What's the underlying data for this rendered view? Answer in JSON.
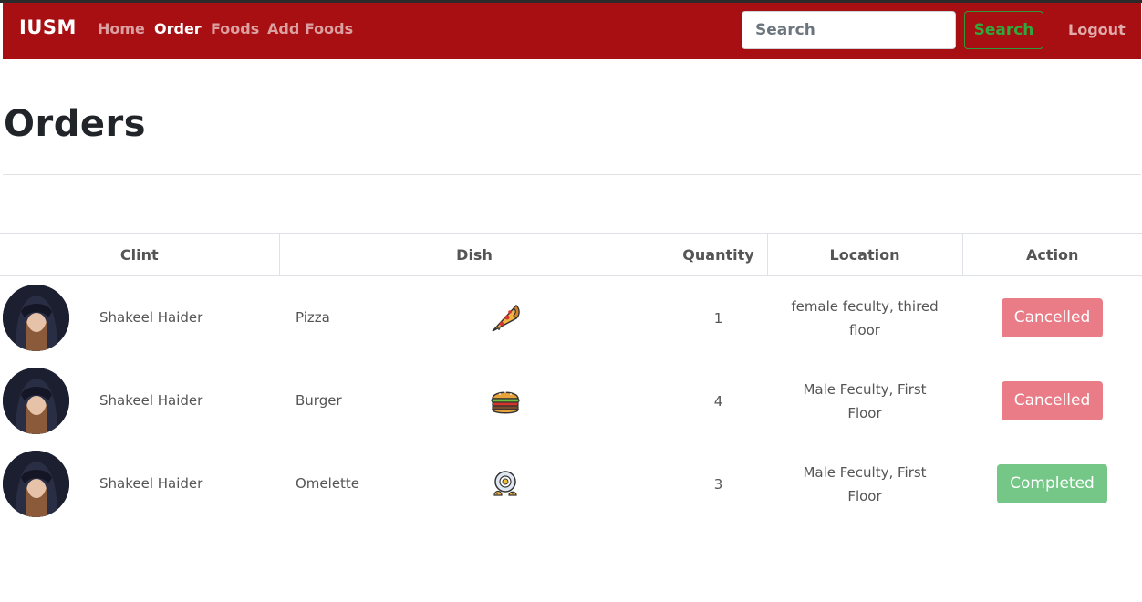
{
  "navbar": {
    "brand": "IUSM",
    "links": [
      {
        "label": "Home",
        "active": false
      },
      {
        "label": "Order",
        "active": true
      },
      {
        "label": "Foods",
        "active": false
      },
      {
        "label": "Add Foods",
        "active": false
      }
    ],
    "search_placeholder": "Search",
    "search_button": "Search",
    "logout": "Logout"
  },
  "colors": {
    "navbar_bg": "#a80f12",
    "search_button": "#2fa83c",
    "cancelled": "#e97c86",
    "completed": "#74c786"
  },
  "page": {
    "title": "Orders"
  },
  "table": {
    "headers": [
      "Clint",
      "Dish",
      "Quantity",
      "Location",
      "Action"
    ],
    "rows": [
      {
        "client": "Shakeel Haider",
        "avatar_icon": "user-avatar-hooded",
        "dish": "Pizza",
        "dish_icon": "pizza-icon",
        "quantity": "1",
        "location": "female feculty, thired floor",
        "action": "Cancelled"
      },
      {
        "client": "Shakeel Haider",
        "avatar_icon": "user-avatar-hooded",
        "dish": "Burger",
        "dish_icon": "burger-icon",
        "quantity": "4",
        "location": "Male Feculty, First Floor",
        "action": "Cancelled"
      },
      {
        "client": "Shakeel Haider",
        "avatar_icon": "user-avatar-hooded",
        "dish": "Omelette",
        "dish_icon": "omelette-icon",
        "quantity": "3",
        "location": "Male Feculty, First Floor",
        "action": "Completed"
      }
    ]
  }
}
